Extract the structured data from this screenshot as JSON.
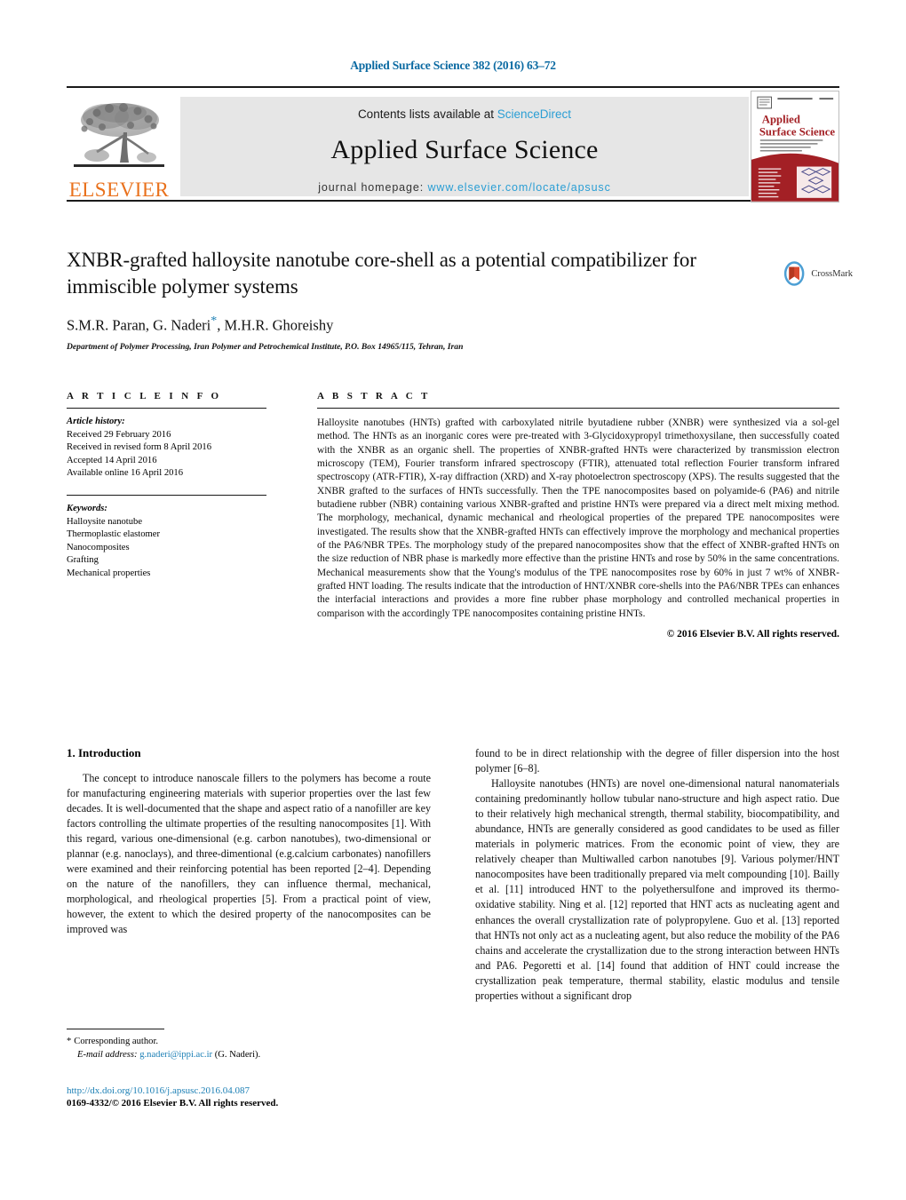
{
  "header": {
    "citation": "Applied Surface Science 382 (2016) 63–72",
    "contents_prefix": "Contents lists available at ",
    "sciencedirect": "ScienceDirect",
    "journal_title": "Applied Surface Science",
    "homepage_prefix": "journal homepage: ",
    "homepage_url": "www.elsevier.com/locate/apsusc",
    "publisher": "ELSEVIER",
    "cover_title_line1": "Applied",
    "cover_title_line2": "Surface Science",
    "crossmark_label": "CrossMark"
  },
  "colors": {
    "link_blue": "#1b7fb5",
    "sciencedirect_blue": "#2a9ed4",
    "elsevier_orange": "#E9711C",
    "band_grey": "#e6e6e6",
    "cover_red": "#a32025"
  },
  "article": {
    "title": "XNBR-grafted halloysite nanotube core-shell as a potential compatibilizer for immiscible polymer systems",
    "authors": "S.M.R. Paran, G. Naderi",
    "authors_tail": ", M.H.R. Ghoreishy",
    "corresponding_marker": "*",
    "affiliation": "Department of Polymer Processing, Iran Polymer and Petrochemical Institute, P.O. Box 14965/115, Tehran, Iran"
  },
  "info": {
    "heading": "A R T I C L E   I N F O",
    "history_label": "Article history:",
    "history": [
      "Received 29 February 2016",
      "Received in revised form 8 April 2016",
      "Accepted 14 April 2016",
      "Available online 16 April 2016"
    ],
    "keywords_label": "Keywords:",
    "keywords": [
      "Halloysite nanotube",
      "Thermoplastic elastomer",
      "Nanocomposites",
      "Grafting",
      "Mechanical properties"
    ]
  },
  "abstract": {
    "heading": "A B S T R A C T",
    "text": "Halloysite nanotubes (HNTs) grafted with carboxylated nitrile byutadiene rubber (XNBR) were synthesized via a sol-gel method. The HNTs as an inorganic cores were pre-treated with 3-Glycidoxypropyl trimethoxysilane, then successfully coated with the XNBR as an organic shell. The properties of XNBR-grafted HNTs were characterized by transmission electron microscopy (TEM), Fourier transform infrared spectroscopy (FTIR), attenuated total reflection Fourier transform infrared spectroscopy (ATR-FTIR), X-ray diffraction (XRD) and X-ray photoelectron spectroscopy (XPS). The results suggested that the XNBR grafted to the surfaces of HNTs successfully. Then the TPE nanocomposites based on polyamide-6 (PA6) and nitrile butadiene rubber (NBR) containing various XNBR-grafted and pristine HNTs were prepared via a direct melt mixing method. The morphology, mechanical, dynamic mechanical and rheological properties of the prepared TPE nanocomposites were investigated. The results show that the XNBR-grafted HNTs can effectively improve the morphology and mechanical properties of the PA6/NBR TPEs. The morphology study of the prepared nanocomposites show that the effect of XNBR-grafted HNTs on the size reduction of NBR phase is markedly more effective than the pristine HNTs and rose by 50% in the same concentrations. Mechanical measurements show that the Young's modulus of the TPE nanocomposites rose by 60% in just 7 wt% of XNBR-grafted HNT loading. The results indicate that the introduction of HNT/XNBR core-shells into the PA6/NBR TPEs can enhances the interfacial interactions and provides a more fine rubber phase morphology and controlled mechanical properties in comparison with the accordingly TPE nanocomposites containing pristine HNTs.",
    "copyright": "© 2016 Elsevier B.V. All rights reserved."
  },
  "body": {
    "section_heading": "1. Introduction",
    "left_para_1": "The concept to introduce nanoscale fillers to the polymers has become a route for manufacturing engineering materials with superior properties over the last few decades. It is well-documented that the shape and aspect ratio of a nanofiller are key factors controlling the ultimate properties of the resulting nanocomposites [1]. With this regard, various one-dimensional (e.g. carbon nanotubes), two-dimensional or plannar (e.g. nanoclays), and three-dimentional (e.g.calcium carbonates) nanofillers were examined and their reinforcing potential has been reported [2–4]. Depending on the nature of the nanofillers, they can influence thermal, mechanical, morphological, and rheological properties [5]. From a practical point of view, however, the extent to which the desired property of the nanocomposites can be improved was",
    "right_para_1": "found to be in direct relationship with the degree of filler dispersion into the host polymer [6–8].",
    "right_para_2": "Halloysite nanotubes (HNTs) are novel one-dimensional natural nanomaterials containing predominantly hollow tubular nano-structure and high aspect ratio. Due to their relatively high mechanical strength, thermal stability, biocompatibility, and abundance, HNTs are generally considered as good candidates to be used as filler materials in polymeric matrices. From the economic point of view, they are relatively cheaper than Multiwalled carbon nanotubes [9]. Various polymer/HNT nanocomposites have been traditionally prepared via melt compounding [10]. Bailly et al. [11] introduced HNT to the polyethersulfone and improved its thermo-oxidative stability. Ning et al. [12] reported that HNT acts as nucleating agent and enhances the overall crystallization rate of polypropylene. Guo et al. [13] reported that HNTs not only act as a nucleating agent, but also reduce the mobility of the PA6 chains and accelerate the crystallization due to the strong interaction between HNTs and PA6. Pegoretti et al. [14] found that addition of HNT could increase the crystallization peak temperature, thermal stability, elastic modulus and tensile properties without a significant drop"
  },
  "footer": {
    "corresponding_star": "*",
    "corresponding_text": "Corresponding author.",
    "email_label": "E-mail address:",
    "email": "g.naderi@ippi.ac.ir",
    "email_owner": "(G. Naderi).",
    "doi": "http://dx.doi.org/10.1016/j.apsusc.2016.04.087",
    "issn_line": "0169-4332/© 2016 Elsevier B.V. All rights reserved."
  }
}
